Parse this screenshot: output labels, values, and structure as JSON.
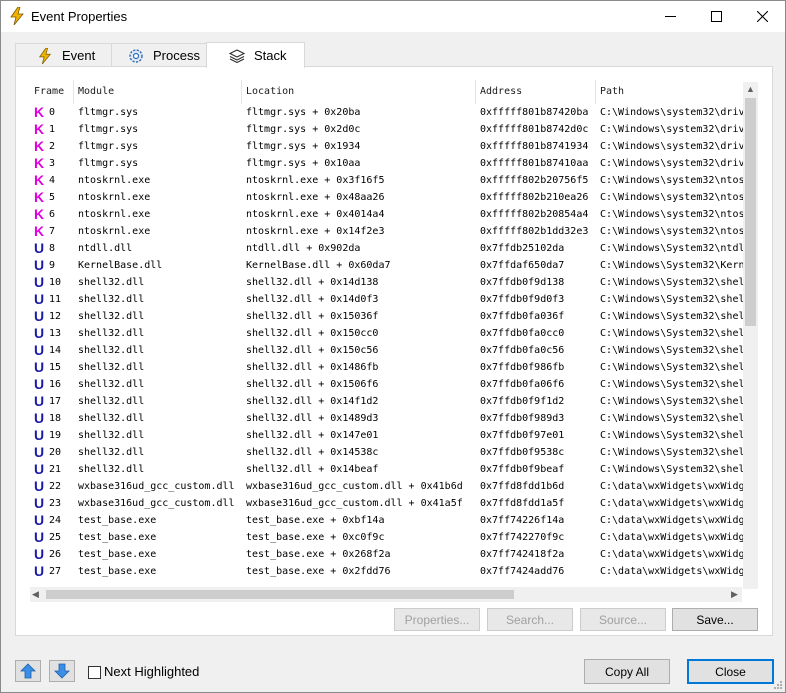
{
  "window": {
    "title": "Event Properties"
  },
  "tabs": [
    {
      "label": "Event",
      "icon": "lightning-icon"
    },
    {
      "label": "Process",
      "icon": "gear-icon"
    },
    {
      "label": "Stack",
      "icon": "layers-icon"
    }
  ],
  "columns": [
    "Frame",
    "Module",
    "Location",
    "Address",
    "Path"
  ],
  "rows": [
    {
      "mode": "K",
      "frame": "0",
      "module": "fltmgr.sys",
      "location": "fltmgr.sys + 0x20ba",
      "address": "0xfffff801b87420ba",
      "path": "C:\\Windows\\system32\\driv"
    },
    {
      "mode": "K",
      "frame": "1",
      "module": "fltmgr.sys",
      "location": "fltmgr.sys + 0x2d0c",
      "address": "0xfffff801b8742d0c",
      "path": "C:\\Windows\\system32\\driv"
    },
    {
      "mode": "K",
      "frame": "2",
      "module": "fltmgr.sys",
      "location": "fltmgr.sys + 0x1934",
      "address": "0xfffff801b8741934",
      "path": "C:\\Windows\\system32\\driv"
    },
    {
      "mode": "K",
      "frame": "3",
      "module": "fltmgr.sys",
      "location": "fltmgr.sys + 0x10aa",
      "address": "0xfffff801b87410aa",
      "path": "C:\\Windows\\system32\\driv"
    },
    {
      "mode": "K",
      "frame": "4",
      "module": "ntoskrnl.exe",
      "location": "ntoskrnl.exe + 0x3f16f5",
      "address": "0xfffff802b20756f5",
      "path": "C:\\Windows\\system32\\ntos"
    },
    {
      "mode": "K",
      "frame": "5",
      "module": "ntoskrnl.exe",
      "location": "ntoskrnl.exe + 0x48aa26",
      "address": "0xfffff802b210ea26",
      "path": "C:\\Windows\\system32\\ntos"
    },
    {
      "mode": "K",
      "frame": "6",
      "module": "ntoskrnl.exe",
      "location": "ntoskrnl.exe + 0x4014a4",
      "address": "0xfffff802b20854a4",
      "path": "C:\\Windows\\system32\\ntos"
    },
    {
      "mode": "K",
      "frame": "7",
      "module": "ntoskrnl.exe",
      "location": "ntoskrnl.exe + 0x14f2e3",
      "address": "0xfffff802b1dd32e3",
      "path": "C:\\Windows\\system32\\ntos"
    },
    {
      "mode": "U",
      "frame": "8",
      "module": "ntdll.dll",
      "location": "ntdll.dll + 0x902da",
      "address": "0x7ffdb25102da",
      "path": "C:\\Windows\\System32\\ntdl"
    },
    {
      "mode": "U",
      "frame": "9",
      "module": "KernelBase.dll",
      "location": "KernelBase.dll + 0x60da7",
      "address": "0x7ffdaf650da7",
      "path": "C:\\Windows\\System32\\Kern"
    },
    {
      "mode": "U",
      "frame": "10",
      "module": "shell32.dll",
      "location": "shell32.dll + 0x14d138",
      "address": "0x7ffdb0f9d138",
      "path": "C:\\Windows\\System32\\shel"
    },
    {
      "mode": "U",
      "frame": "11",
      "module": "shell32.dll",
      "location": "shell32.dll + 0x14d0f3",
      "address": "0x7ffdb0f9d0f3",
      "path": "C:\\Windows\\System32\\shel"
    },
    {
      "mode": "U",
      "frame": "12",
      "module": "shell32.dll",
      "location": "shell32.dll + 0x15036f",
      "address": "0x7ffdb0fa036f",
      "path": "C:\\Windows\\System32\\shel"
    },
    {
      "mode": "U",
      "frame": "13",
      "module": "shell32.dll",
      "location": "shell32.dll + 0x150cc0",
      "address": "0x7ffdb0fa0cc0",
      "path": "C:\\Windows\\System32\\shel"
    },
    {
      "mode": "U",
      "frame": "14",
      "module": "shell32.dll",
      "location": "shell32.dll + 0x150c56",
      "address": "0x7ffdb0fa0c56",
      "path": "C:\\Windows\\System32\\shel"
    },
    {
      "mode": "U",
      "frame": "15",
      "module": "shell32.dll",
      "location": "shell32.dll + 0x1486fb",
      "address": "0x7ffdb0f986fb",
      "path": "C:\\Windows\\System32\\shel"
    },
    {
      "mode": "U",
      "frame": "16",
      "module": "shell32.dll",
      "location": "shell32.dll + 0x1506f6",
      "address": "0x7ffdb0fa06f6",
      "path": "C:\\Windows\\System32\\shel"
    },
    {
      "mode": "U",
      "frame": "17",
      "module": "shell32.dll",
      "location": "shell32.dll + 0x14f1d2",
      "address": "0x7ffdb0f9f1d2",
      "path": "C:\\Windows\\System32\\shel"
    },
    {
      "mode": "U",
      "frame": "18",
      "module": "shell32.dll",
      "location": "shell32.dll + 0x1489d3",
      "address": "0x7ffdb0f989d3",
      "path": "C:\\Windows\\System32\\shel"
    },
    {
      "mode": "U",
      "frame": "19",
      "module": "shell32.dll",
      "location": "shell32.dll + 0x147e01",
      "address": "0x7ffdb0f97e01",
      "path": "C:\\Windows\\System32\\shel"
    },
    {
      "mode": "U",
      "frame": "20",
      "module": "shell32.dll",
      "location": "shell32.dll + 0x14538c",
      "address": "0x7ffdb0f9538c",
      "path": "C:\\Windows\\System32\\shel"
    },
    {
      "mode": "U",
      "frame": "21",
      "module": "shell32.dll",
      "location": "shell32.dll + 0x14beaf",
      "address": "0x7ffdb0f9beaf",
      "path": "C:\\Windows\\System32\\shel"
    },
    {
      "mode": "U",
      "frame": "22",
      "module": "wxbase316ud_gcc_custom.dll",
      "location": "wxbase316ud_gcc_custom.dll + 0x41b6d",
      "address": "0x7ffd8fdd1b6d",
      "path": "C:\\data\\wxWidgets\\wxWidg"
    },
    {
      "mode": "U",
      "frame": "23",
      "module": "wxbase316ud_gcc_custom.dll",
      "location": "wxbase316ud_gcc_custom.dll + 0x41a5f",
      "address": "0x7ffd8fdd1a5f",
      "path": "C:\\data\\wxWidgets\\wxWidg"
    },
    {
      "mode": "U",
      "frame": "24",
      "module": "test_base.exe",
      "location": "test_base.exe + 0xbf14a",
      "address": "0x7ff74226f14a",
      "path": "C:\\data\\wxWidgets\\wxWidg"
    },
    {
      "mode": "U",
      "frame": "25",
      "module": "test_base.exe",
      "location": "test_base.exe + 0xc0f9c",
      "address": "0x7ff742270f9c",
      "path": "C:\\data\\wxWidgets\\wxWidg"
    },
    {
      "mode": "U",
      "frame": "26",
      "module": "test_base.exe",
      "location": "test_base.exe + 0x268f2a",
      "address": "0x7ff742418f2a",
      "path": "C:\\data\\wxWidgets\\wxWidg"
    },
    {
      "mode": "U",
      "frame": "27",
      "module": "test_base.exe",
      "location": "test_base.exe + 0x2fdd76",
      "address": "0x7ff7424add76",
      "path": "C:\\data\\wxWidgets\\wxWidg"
    }
  ],
  "buttons": {
    "properties": "Properties...",
    "search": "Search...",
    "source": "Source...",
    "save": "Save...",
    "copy_all": "Copy All",
    "close": "Close"
  },
  "next_highlighted": {
    "label": "Next Highlighted",
    "checked": false
  },
  "colors": {
    "kernel_mark": "#e000e0",
    "user_mark": "#1a1aa8",
    "lightning": "#f0b400",
    "accent": "#0078d7"
  }
}
